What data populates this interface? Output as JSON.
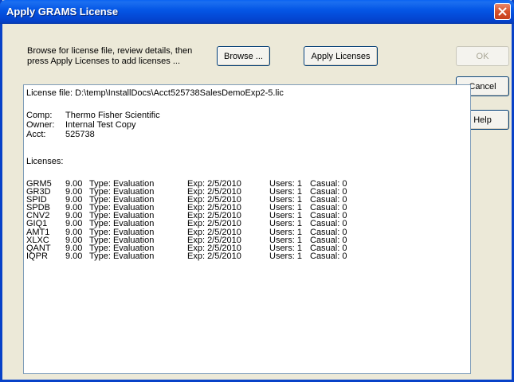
{
  "window": {
    "title": "Apply GRAMS License"
  },
  "instructions": "Browse for license file, review details, then press Apply Licenses to add licenses ...",
  "buttons": {
    "browse": "Browse ...",
    "apply": "Apply Licenses",
    "ok": "OK",
    "cancel": "Cancel",
    "help": "Help"
  },
  "details": {
    "license_file": "License file: D:\\temp\\InstallDocs\\Acct525738SalesDemoExp2-5.lic",
    "comp_label": "Comp:",
    "comp_value": "Thermo Fisher Scientific",
    "owner_label": "Owner:",
    "owner_value": "Internal Test Copy",
    "acct_label": "Acct:",
    "acct_value": "525738",
    "licenses_label": "Licenses:"
  },
  "licenses": [
    {
      "code": "GRM5",
      "version": "9.00",
      "type": "Type: Evaluation",
      "exp": "Exp: 2/5/2010",
      "users": "Users: 1",
      "casual": "Casual: 0"
    },
    {
      "code": "GR3D",
      "version": "9.00",
      "type": "Type: Evaluation",
      "exp": "Exp: 2/5/2010",
      "users": "Users: 1",
      "casual": "Casual: 0"
    },
    {
      "code": "SPID",
      "version": "9.00",
      "type": "Type: Evaluation",
      "exp": "Exp: 2/5/2010",
      "users": "Users: 1",
      "casual": "Casual: 0"
    },
    {
      "code": "SPDB",
      "version": "9.00",
      "type": "Type: Evaluation",
      "exp": "Exp: 2/5/2010",
      "users": "Users: 1",
      "casual": "Casual: 0"
    },
    {
      "code": "CNV2",
      "version": "9.00",
      "type": "Type: Evaluation",
      "exp": "Exp: 2/5/2010",
      "users": "Users: 1",
      "casual": "Casual: 0"
    },
    {
      "code": "GIQ1",
      "version": "9.00",
      "type": "Type: Evaluation",
      "exp": "Exp: 2/5/2010",
      "users": "Users: 1",
      "casual": "Casual: 0"
    },
    {
      "code": "AMT1",
      "version": "9.00",
      "type": "Type: Evaluation",
      "exp": "Exp: 2/5/2010",
      "users": "Users: 1",
      "casual": "Casual: 0"
    },
    {
      "code": "XLXC",
      "version": "9.00",
      "type": "Type: Evaluation",
      "exp": "Exp: 2/5/2010",
      "users": "Users: 1",
      "casual": "Casual: 0"
    },
    {
      "code": "QANT",
      "version": "9.00",
      "type": "Type: Evaluation",
      "exp": "Exp: 2/5/2010",
      "users": "Users: 1",
      "casual": "Casual: 0"
    },
    {
      "code": "IQPR",
      "version": "9.00",
      "type": "Type: Evaluation",
      "exp": "Exp: 2/5/2010",
      "users": "Users: 1",
      "casual": "Casual: 0"
    }
  ],
  "icons": {
    "close": "close-icon"
  },
  "colors": {
    "titlebar": "#0557e6",
    "close": "#d6522b",
    "dialog": "#ece9d8"
  }
}
